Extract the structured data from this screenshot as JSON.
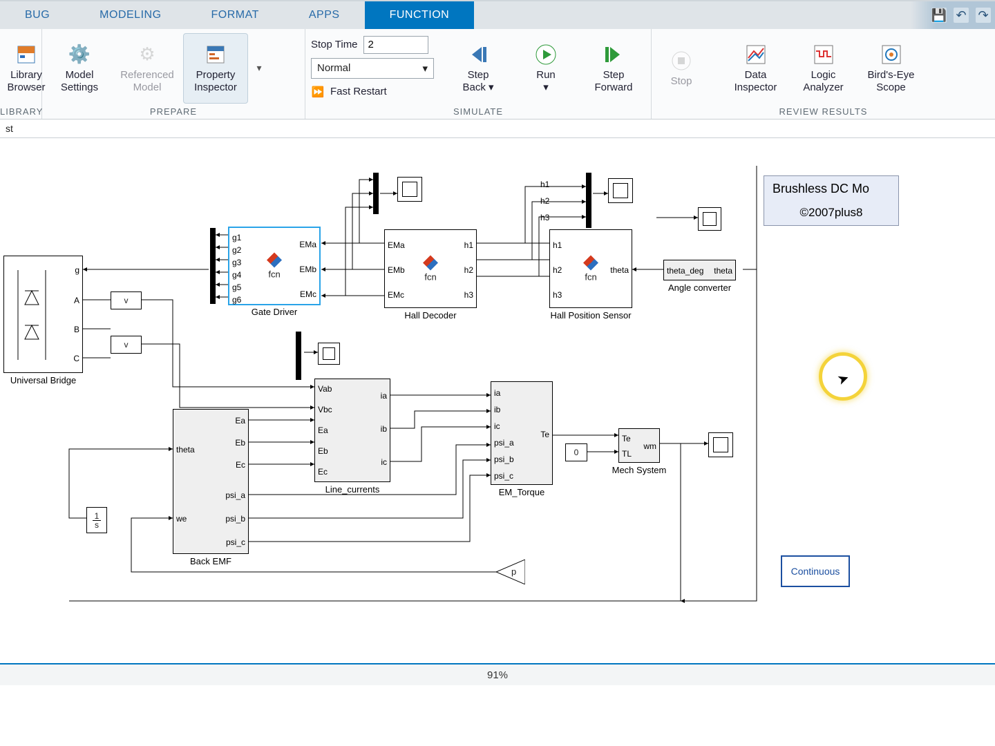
{
  "tabs": {
    "items": [
      "BUG",
      "MODELING",
      "FORMAT",
      "APPS",
      "FUNCTION"
    ],
    "active_index": 4
  },
  "titlebar_tools": {
    "save_icon": "save-icon",
    "undo_icon": "undo-icon",
    "redo_icon": "redo-icon"
  },
  "ribbon": {
    "library": {
      "label": "LIBRARY",
      "lib_browser_line1": "Library",
      "lib_browser_line2": "Browser"
    },
    "prepare": {
      "label": "PREPARE",
      "model_settings_line1": "Model",
      "model_settings_line2": "Settings",
      "ref_model_line1": "Referenced",
      "ref_model_line2": "Model",
      "prop_insp_line1": "Property",
      "prop_insp_line2": "Inspector"
    },
    "simulate": {
      "label": "SIMULATE",
      "stop_time_label": "Stop Time",
      "stop_time_value": "2",
      "mode_value": "Normal",
      "fast_restart": "Fast Restart",
      "step_back_line1": "Step",
      "step_back_line2": "Back",
      "run": "Run",
      "step_fwd_line1": "Step",
      "step_fwd_line2": "Forward",
      "stop": "Stop"
    },
    "review": {
      "label": "REVIEW RESULTS",
      "data_insp_line1": "Data",
      "data_insp_line2": "Inspector",
      "logic_line1": "Logic",
      "logic_line2": "Analyzer",
      "birds_line1": "Bird's-Eye",
      "birds_line2": "Scope"
    }
  },
  "pathbar": {
    "text": "st"
  },
  "blocks": {
    "universal_bridge": {
      "label": "Universal Bridge",
      "ports_right": [
        "g",
        "A",
        "B",
        "C"
      ]
    },
    "gate_driver": {
      "label": "Gate Driver",
      "fcn": "fcn",
      "ports_left": [
        "g1",
        "g2",
        "g3",
        "g4",
        "g5",
        "g6"
      ],
      "ports_right": [
        "EMa",
        "EMb",
        "EMc"
      ]
    },
    "hall_decoder": {
      "label": "Hall Decoder",
      "fcn": "fcn",
      "ports_left": [
        "EMa",
        "EMb",
        "EMc"
      ],
      "ports_right": [
        "h1",
        "h2",
        "h3"
      ]
    },
    "hall_pos": {
      "label": "Hall Position Sensor",
      "fcn": "fcn",
      "ports_left": [
        "h1",
        "h2",
        "h3"
      ],
      "ports_right": [
        "theta"
      ]
    },
    "angle_conv": {
      "label": "Angle converter",
      "ports": {
        "left": "theta_deg",
        "right": "theta"
      }
    },
    "hall_signals": [
      "h1",
      "h2",
      "h3"
    ],
    "back_emf": {
      "label": "Back EMF",
      "ports_left": [
        "theta",
        "we"
      ],
      "ports_right": [
        "Ea",
        "Eb",
        "Ec",
        "psi_a",
        "psi_b",
        "psi_c"
      ]
    },
    "line_currents": {
      "label": "Line_currents",
      "ports_left": [
        "Vab",
        "Vbc",
        "Ea",
        "Eb",
        "Ec"
      ],
      "ports_right": [
        "ia",
        "ib",
        "ic"
      ]
    },
    "em_torque": {
      "label": "EM_Torque",
      "ports_left": [
        "ia",
        "ib",
        "ic",
        "psi_a",
        "psi_b",
        "psi_c"
      ],
      "ports_right": [
        "Te"
      ]
    },
    "mech": {
      "label": "Mech System",
      "ports_left": [
        "Te",
        "TL"
      ],
      "ports_right": [
        "wm"
      ]
    },
    "const0": "0",
    "integrator": "1\ns",
    "gain_p": "p",
    "vmeas": "v",
    "annot_line1": "Brushless DC Mo",
    "annot_line2": "©2007plus8",
    "powergui": "Continuous"
  },
  "statusbar": {
    "zoom": "91%"
  }
}
